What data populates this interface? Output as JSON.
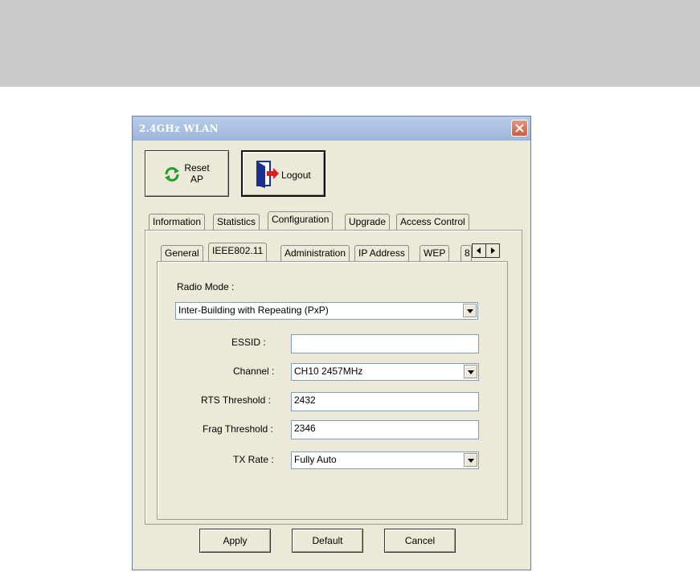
{
  "window": {
    "title": "2.4GHz WLAN"
  },
  "toolbar": {
    "reset_label_line1": "Reset",
    "reset_label_line2": "AP",
    "logout_label": "Logout"
  },
  "main_tabs": [
    "Information",
    "Statistics",
    "Configuration",
    "Upgrade",
    "Access Control"
  ],
  "sub_tabs": [
    "General",
    "IEEE802.11",
    "Administration",
    "IP Address",
    "WEP",
    "8"
  ],
  "form": {
    "radio_mode_label": "Radio Mode :",
    "radio_mode_value": "Inter-Building with Repeating (PxP)",
    "essid_label": "ESSID :",
    "essid_value": "",
    "channel_label": "Channel :",
    "channel_value": "CH10 2457MHz",
    "rts_label": "RTS Threshold :",
    "rts_value": "2432",
    "frag_label": "Frag Threshold :",
    "frag_value": "2346",
    "tx_label": "TX Rate :",
    "tx_value": "Fully Auto"
  },
  "buttons": {
    "apply": "Apply",
    "default": "Default",
    "cancel": "Cancel"
  },
  "colors": {
    "titlebar": "#a8bfe0",
    "close": "#d05d3d",
    "face": "#ece9d8"
  }
}
